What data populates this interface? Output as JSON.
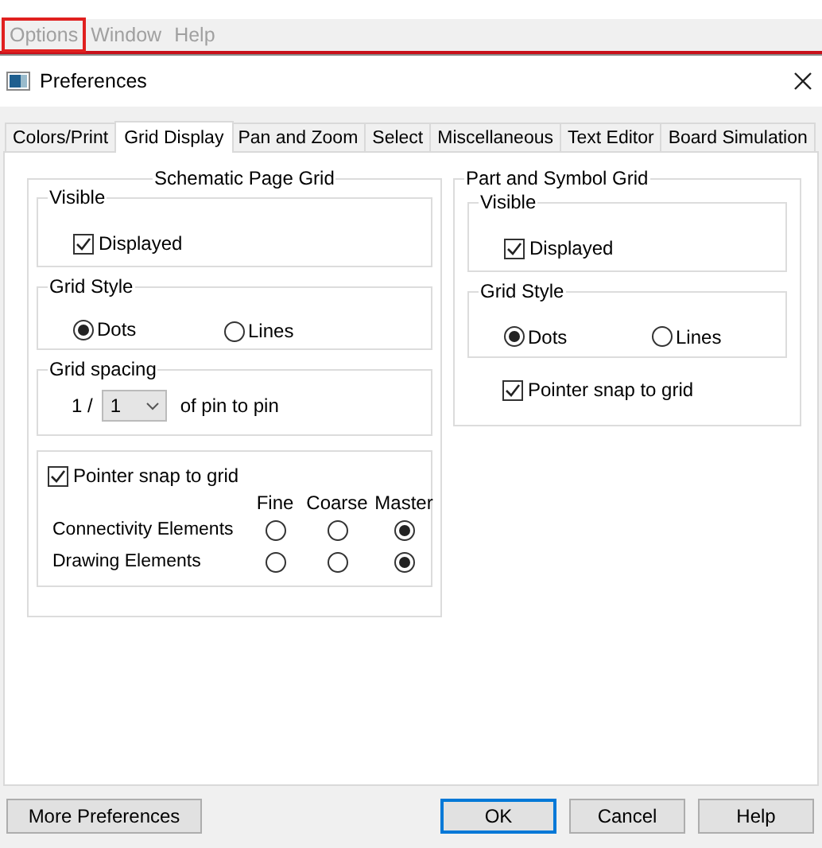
{
  "menu_bar": {
    "items": [
      {
        "label": "Options",
        "highlighted": true
      },
      {
        "label": "Window",
        "highlighted": false
      },
      {
        "label": "Help",
        "highlighted": false
      }
    ]
  },
  "dialog": {
    "title": "Preferences",
    "tabs": [
      {
        "label": "Colors/Print",
        "selected": false
      },
      {
        "label": "Grid Display",
        "selected": true
      },
      {
        "label": "Pan and Zoom",
        "selected": false
      },
      {
        "label": "Select",
        "selected": false
      },
      {
        "label": "Miscellaneous",
        "selected": false
      },
      {
        "label": "Text Editor",
        "selected": false
      },
      {
        "label": "Board Simulation",
        "selected": false
      }
    ],
    "schematic_page_grid": {
      "title": "Schematic Page Grid",
      "visible": {
        "title": "Visible",
        "displayed": {
          "label": "Displayed",
          "checked": true
        }
      },
      "grid_style": {
        "title": "Grid Style",
        "options": [
          {
            "label": "Dots",
            "selected": true
          },
          {
            "label": "Lines",
            "selected": false
          }
        ]
      },
      "grid_spacing": {
        "title": "Grid spacing",
        "prefix": "1 /",
        "value": "1",
        "suffix": "of pin to pin"
      },
      "snap": {
        "label": "Pointer snap to grid",
        "checked": true,
        "columns": [
          "Fine",
          "Coarse",
          "Master"
        ],
        "rows": [
          {
            "label": "Connectivity Elements",
            "options": [
              {
                "selected": false
              },
              {
                "selected": false
              },
              {
                "selected": true
              }
            ]
          },
          {
            "label": "Drawing Elements",
            "options": [
              {
                "selected": false
              },
              {
                "selected": false
              },
              {
                "selected": true
              }
            ]
          }
        ]
      }
    },
    "part_and_symbol_grid": {
      "title": "Part and Symbol Grid",
      "visible": {
        "title": "Visible",
        "displayed": {
          "label": "Displayed",
          "checked": true
        }
      },
      "grid_style": {
        "title": "Grid Style",
        "options": [
          {
            "label": "Dots",
            "selected": true
          },
          {
            "label": "Lines",
            "selected": false
          }
        ]
      },
      "snap": {
        "label": "Pointer snap to grid",
        "checked": true
      }
    },
    "buttons": [
      {
        "label": "More Preferences",
        "kind": "plain"
      },
      {
        "label": "OK",
        "kind": "default"
      },
      {
        "label": "Cancel",
        "kind": "plain"
      },
      {
        "label": "Help",
        "kind": "plain"
      }
    ]
  }
}
